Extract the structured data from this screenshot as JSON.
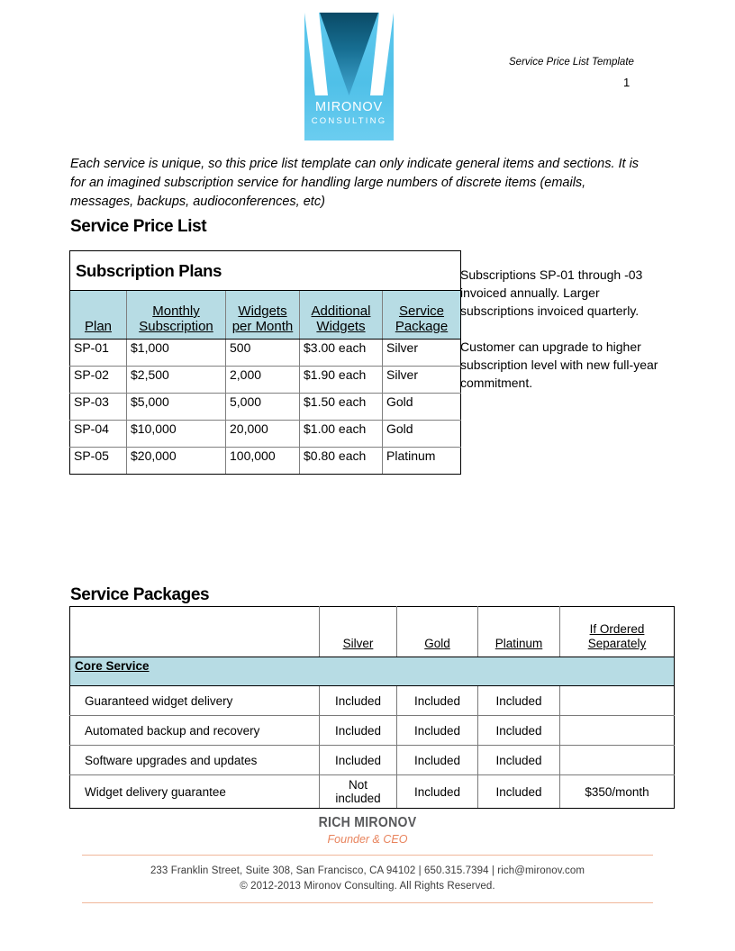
{
  "header": {
    "logo": {
      "name": "MIRONOV",
      "subtitle": "CONSULTING",
      "bg_color": "#4fc0e8",
      "v_color": "#0a4a66"
    },
    "doc_title": "Service Price List Template",
    "page_number": "1"
  },
  "intro": "Each service is unique, so this price list template can only indicate general items and sections.  It is for an imagined subscription service for handling large numbers of discrete items (emails, messages, backups, audioconferences, etc)",
  "sections": {
    "price_list_heading": "Service Price List",
    "packages_heading": "Service Packages"
  },
  "subscription_table": {
    "title": "Subscription Plans",
    "header_bg": "#b7dce4",
    "columns": [
      "Plan",
      "Monthly Subscription",
      "Widgets per Month",
      "Additional Widgets",
      "Service Package"
    ],
    "columns_wrapped": [
      [
        "Plan"
      ],
      [
        "Monthly",
        "Subscription"
      ],
      [
        "Widgets",
        "per Month"
      ],
      [
        "Additional",
        "Widgets"
      ],
      [
        "Service",
        "Package"
      ]
    ],
    "rows": [
      [
        "SP-01",
        "$1,000",
        "500",
        "$3.00 each",
        "Silver"
      ],
      [
        "SP-02",
        "$2,500",
        "2,000",
        "$1.90 each",
        "Silver"
      ],
      [
        "SP-03",
        "$5,000",
        "5,000",
        "$1.50 each",
        "Gold"
      ],
      [
        "SP-04",
        "$10,000",
        "20,000",
        "$1.00 each",
        "Gold"
      ],
      [
        "SP-05",
        "$20,000",
        "100,000",
        "$0.80 each",
        "Platinum"
      ]
    ]
  },
  "side_note": {
    "paragraph_1": "Subscriptions SP-01 through -03 invoiced annually.  Larger subscriptions invoiced quarterly.",
    "paragraph_2": "Customer can upgrade to higher subscription level with new full-year commitment."
  },
  "packages_table": {
    "header_bg": "#b7dce4",
    "columns": [
      "",
      "Silver",
      "Gold",
      "Platinum",
      "If Ordered Separately"
    ],
    "columns_wrapped": [
      [
        ""
      ],
      [
        "Silver"
      ],
      [
        "Gold"
      ],
      [
        "Platinum"
      ],
      [
        "If Ordered",
        "Separately"
      ]
    ],
    "group_label": "Core Service",
    "rows": [
      [
        "Guaranteed widget delivery",
        "Included",
        "Included",
        "Included",
        ""
      ],
      [
        "Automated backup and recovery",
        "Included",
        "Included",
        "Included",
        ""
      ],
      [
        "Software upgrades and updates",
        "Included",
        "Included",
        "Included",
        ""
      ],
      [
        "Widget delivery guarantee",
        "Not included",
        "Included",
        "Included",
        "$350/month"
      ]
    ]
  },
  "footer": {
    "name": "RICH MIRONOV",
    "role": "Founder & CEO",
    "address": "233 Franklin Street, Suite 308, San Francisco, CA 94102  |  650.315.7394  |  rich@mironov.com",
    "copyright": "© 2012-2013 Mironov Consulting. All Rights Reserved.",
    "accent_color": "#e8835c"
  }
}
